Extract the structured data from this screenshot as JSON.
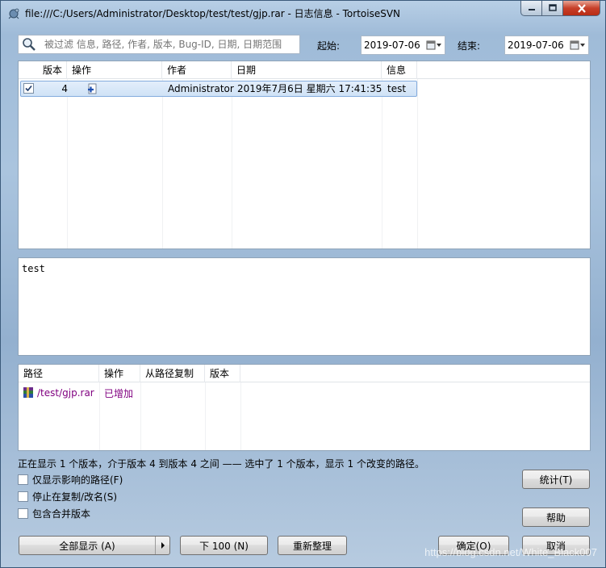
{
  "window": {
    "title": "file:///C:/Users/Administrator/Desktop/test/test/gjp.rar - 日志信息 - TortoiseSVN"
  },
  "filter": {
    "placeholder": "被过滤 信息, 路径, 作者, 版本, Bug-ID, 日期, 日期范围",
    "from_label": "起始:",
    "from_date": "2019-07-06",
    "to_label": "结束:",
    "to_date": "2019-07-06"
  },
  "log_table": {
    "headers": [
      "版本",
      "操作",
      "作者",
      "日期",
      "信息"
    ],
    "rows": [
      {
        "revision": "4",
        "author": "Administrator",
        "date": "2019年7月6日 星期六 17:41:35",
        "message": "test",
        "checked": true,
        "action_icon": "add-icon"
      }
    ]
  },
  "message_panel": {
    "text": "test"
  },
  "paths_table": {
    "headers": [
      "路径",
      "操作",
      "从路径复制",
      "版本"
    ],
    "rows": [
      {
        "path": "/test/gjp.rar",
        "action": "已增加",
        "copy_from": "",
        "revision": "",
        "icon": "rar-archive-icon"
      }
    ]
  },
  "status_text": "正在显示 1 个版本，介于版本 4 到版本 4 之间 —— 选中了 1 个版本，显示 1 个改变的路径。",
  "options": [
    {
      "label": "仅显示影响的路径(F)",
      "checked": false
    },
    {
      "label": "停止在复制/改名(S)",
      "checked": false
    },
    {
      "label": "包含合并版本",
      "checked": false
    }
  ],
  "buttons": {
    "stats": "统计(T)",
    "help": "帮助",
    "show_all": "全部显示 (A)",
    "next_100": "下 100 (N)",
    "refresh": "重新整理",
    "ok": "确定(O)",
    "cancel": "取消"
  },
  "watermark": "https://blog.csdn.net/White_Black007",
  "colors": {
    "path_link": "#800080",
    "action_added": "#800080",
    "selection": "#cfe2f6"
  }
}
